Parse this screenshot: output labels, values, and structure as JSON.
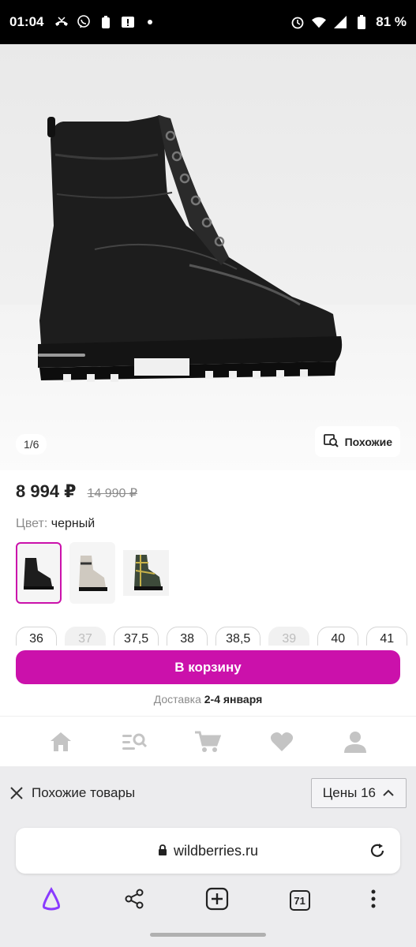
{
  "status_bar": {
    "time": "01:04",
    "battery": "81 %",
    "left_icons": [
      "missed-call-icon",
      "viber-icon",
      "battery-saver-icon",
      "alert-icon",
      "dot-icon"
    ],
    "right_icons": [
      "alarm-icon",
      "wifi-icon",
      "signal-icon",
      "battery-icon"
    ]
  },
  "gallery": {
    "counter": "1/6",
    "similar_button": "Похожие"
  },
  "product": {
    "price": "8 994 ₽",
    "old_price": "14 990 ₽",
    "color_label": "Цвет:",
    "color_value": "черный",
    "swatches": [
      "black-boot",
      "grey-boot",
      "plaid-boot"
    ],
    "sizes": [
      {
        "label": "36",
        "available": true
      },
      {
        "label": "37",
        "available": false
      },
      {
        "label": "37,5",
        "available": true
      },
      {
        "label": "38",
        "available": true
      },
      {
        "label": "38,5",
        "available": true
      },
      {
        "label": "39",
        "available": false
      },
      {
        "label": "40",
        "available": true
      },
      {
        "label": "41",
        "available": true
      }
    ]
  },
  "cart": {
    "button_label": "В корзину",
    "delivery_label": "Доставка",
    "delivery_dates": "2-4 января"
  },
  "bottom_nav": [
    "home-icon",
    "catalog-search-icon",
    "cart-icon",
    "favorites-icon",
    "profile-icon"
  ],
  "similar_bar": {
    "label": "Похожие товары",
    "prices_button": "Цены 16"
  },
  "browser": {
    "url": "wildberries.ru",
    "tabs_count": "71"
  },
  "colors": {
    "accent": "#cb11ab",
    "text": "#242424",
    "muted": "#8b8b8b"
  }
}
